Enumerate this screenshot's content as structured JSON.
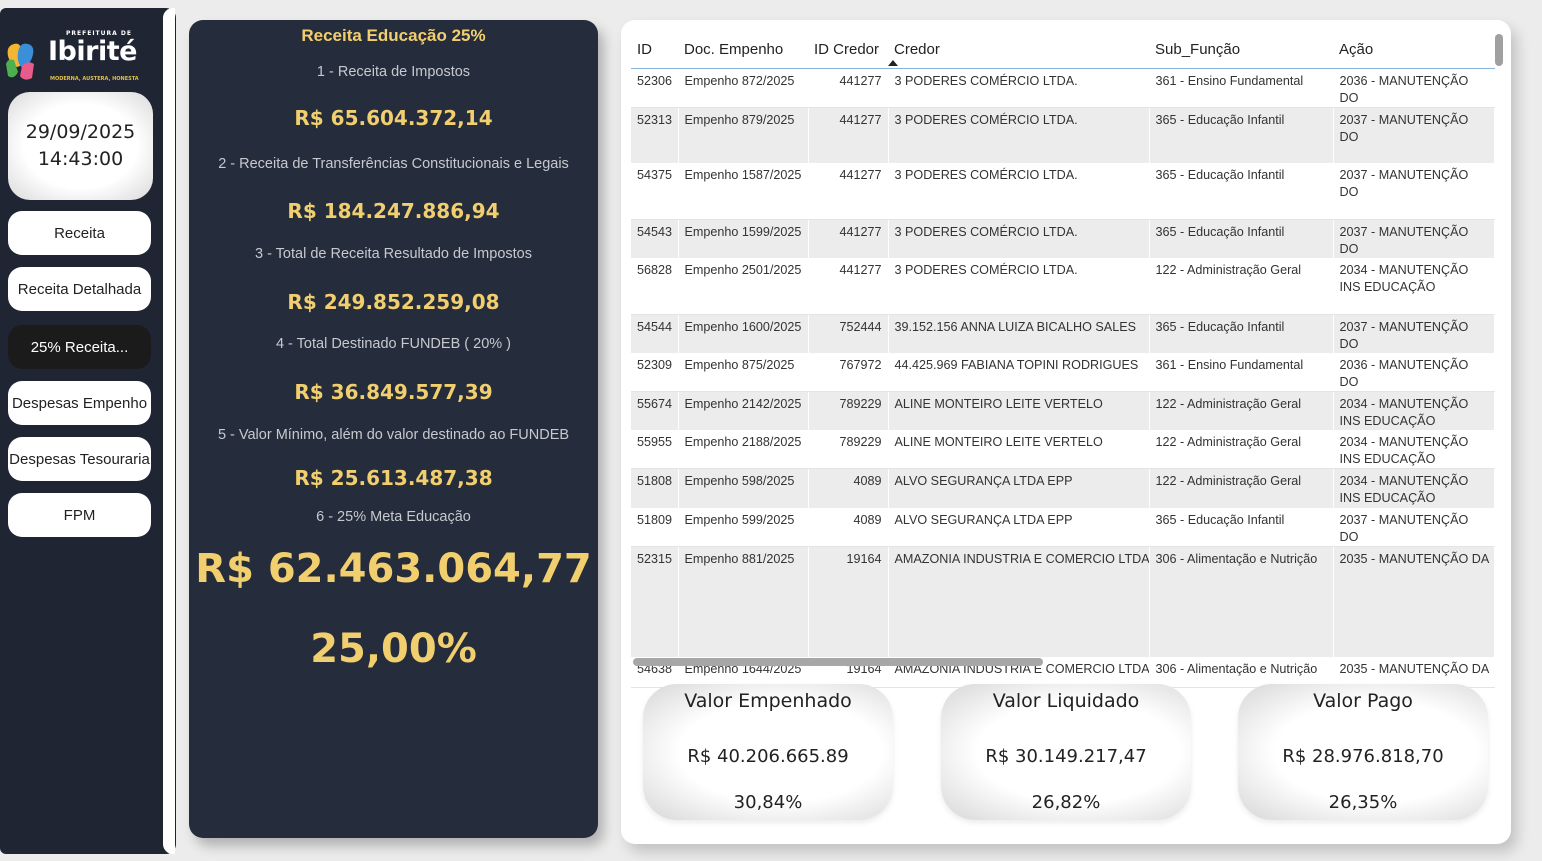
{
  "logo": {
    "prefix": "PREFEITURA DE",
    "name": "Ibirité",
    "motto": "MODERNA, AUSTERA, HONESTA"
  },
  "clock": {
    "date": "29/09/2025",
    "time": "14:43:00"
  },
  "nav": [
    {
      "label": "Receita"
    },
    {
      "label": "Receita Detalhada"
    },
    {
      "label": "25% Receita..."
    },
    {
      "label": "Despesas Empenho"
    },
    {
      "label": "Despesas Tesouraria"
    },
    {
      "label": "FPM"
    }
  ],
  "kpi": {
    "title": "Receita Educação 25%",
    "items": [
      {
        "label": "1 - Receita de Impostos",
        "value": "R$ 65.604.372,14"
      },
      {
        "label": "2 - Receita de Transferências Constitucionais e Legais",
        "value": "R$ 184.247.886,94"
      },
      {
        "label": "3 - Total de Receita Resultado de Impostos",
        "value": "R$ 249.852.259,08"
      },
      {
        "label": "4 - Total Destinado FUNDEB ( 20% )",
        "value": "R$ 36.849.577,39"
      },
      {
        "label": "5 - Valor Mínimo, além do valor destinado ao FUNDEB",
        "value": "R$ 25.613.487,38"
      },
      {
        "label": "6 - 25% Meta Educação",
        "value": "R$ 62.463.064,77"
      }
    ],
    "percent": "25,00%"
  },
  "table": {
    "columns": [
      "ID",
      "Doc. Empenho",
      "ID Credor",
      "Credor",
      "Sub_Função",
      "Ação"
    ],
    "sorted_column": "Credor",
    "rows": [
      [
        "52306",
        "Empenho 872/2025",
        "441277",
        "3 PODERES COMÉRCIO LTDA.",
        "361 - Ensino Fundamental",
        "2036 - MANUTENÇÃO DO"
      ],
      [
        "52313",
        "Empenho 879/2025",
        "441277",
        "3 PODERES COMÉRCIO LTDA.",
        "365 - Educação Infantil",
        "2037 - MANUTENÇÃO DO"
      ],
      [
        "54375",
        "Empenho 1587/2025",
        "441277",
        "3 PODERES COMÉRCIO LTDA.",
        "365 - Educação Infantil",
        "2037 - MANUTENÇÃO DO"
      ],
      [
        "54543",
        "Empenho 1599/2025",
        "441277",
        "3 PODERES COMÉRCIO LTDA.",
        "365 - Educação Infantil",
        "2037 - MANUTENÇÃO DO"
      ],
      [
        "56828",
        "Empenho 2501/2025",
        "441277",
        "3 PODERES COMÉRCIO LTDA.",
        "122 - Administração Geral",
        "2034 - MANUTENÇÃO INS EDUCAÇÃO"
      ],
      [
        "54544",
        "Empenho 1600/2025",
        "752444",
        "39.152.156 ANNA LUIZA BICALHO SALES",
        "365 - Educação Infantil",
        "2037 - MANUTENÇÃO DO"
      ],
      [
        "52309",
        "Empenho 875/2025",
        "767972",
        "44.425.969 FABIANA TOPINI RODRIGUES",
        "361 - Ensino Fundamental",
        "2036 - MANUTENÇÃO DO"
      ],
      [
        "55674",
        "Empenho 2142/2025",
        "789229",
        "ALINE MONTEIRO LEITE VERTELO",
        "122 - Administração Geral",
        "2034 - MANUTENÇÃO INS EDUCAÇÃO"
      ],
      [
        "55955",
        "Empenho 2188/2025",
        "789229",
        "ALINE MONTEIRO LEITE VERTELO",
        "122 - Administração Geral",
        "2034 - MANUTENÇÃO INS EDUCAÇÃO"
      ],
      [
        "51808",
        "Empenho 598/2025",
        "4089",
        "ALVO SEGURANÇA LTDA EPP",
        "122 - Administração Geral",
        "2034 - MANUTENÇÃO INS EDUCAÇÃO"
      ],
      [
        "51809",
        "Empenho 599/2025",
        "4089",
        "ALVO SEGURANÇA LTDA EPP",
        "365 - Educação Infantil",
        "2037 - MANUTENÇÃO DO"
      ],
      [
        "52315",
        "Empenho 881/2025",
        "19164",
        "AMAZONIA INDUSTRIA E COMERCIO LTDA",
        "306 - Alimentação e Nutrição",
        "2035 - MANUTENÇÃO DA"
      ],
      [
        "54638",
        "Empenho 1644/2025",
        "19164",
        "AMAZONIA INDUSTRIA E COMERCIO LTDA",
        "306 - Alimentação e Nutrição",
        "2035 - MANUTENÇÃO DA"
      ]
    ]
  },
  "cards": [
    {
      "title": "Valor Empenhado",
      "value": "R$ 40.206.665.89",
      "percent": "30,84%"
    },
    {
      "title": "Valor Liquidado",
      "value": "R$ 30.149.217,47",
      "percent": "26,82%"
    },
    {
      "title": "Valor Pago",
      "value": "R$ 28.976.818,70",
      "percent": "26,35%"
    }
  ]
}
